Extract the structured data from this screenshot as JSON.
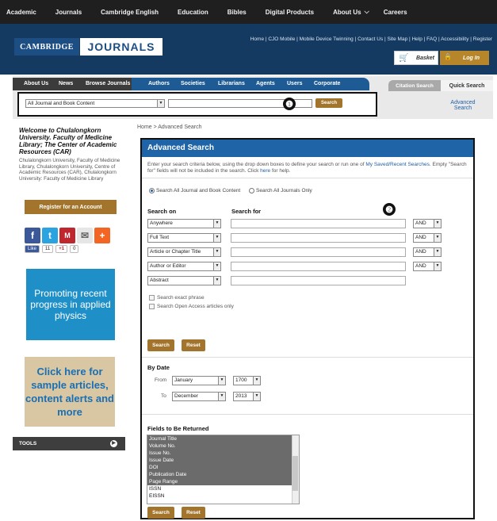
{
  "topnav": [
    "Academic",
    "Journals",
    "Cambridge English",
    "Education",
    "Bibles",
    "Digital Products",
    "About Us",
    "Careers"
  ],
  "logo": {
    "left": "CAMBRIDGE",
    "right": "JOURNALS"
  },
  "toplinks": "Home | CJO Mobile | Mobile Device Twinning | Contact Us | Site Map | Help | FAQ | Accessibility | Register",
  "basket": "Basket",
  "login": "Log In",
  "navtabs": [
    "About Us",
    "News",
    "Browse Journals",
    "Authors",
    "Societies",
    "Librarians",
    "Agents",
    "Users",
    "Corporate"
  ],
  "citation_tab": "Citation Search",
  "quick_tab": "Quick Search",
  "quicksearch": {
    "select": "All Journal and Book Content",
    "button": "Search",
    "advanced": "Advanced Search"
  },
  "markers": [
    "❶",
    "❷"
  ],
  "welcome": "Welcome to Chulalongkorn University. Faculty of Medicine Library; The Center of Academic Resources (CAR)",
  "welcome_sub": "Chulalongkorn University, Faculty of Medicine Library, Chulalongkorn University, Centre of Academic Resources (CAR), Chulalongkorn University: Faculty of Medicine Library",
  "register": "Register for an Account",
  "social_counts": {
    "like": "Like",
    "like_n": "11",
    "gplus": "+1",
    "gplus_n": "0"
  },
  "ad1": "Promoting recent progress in applied physics",
  "ad2": "Click here for sample articles, content alerts and more",
  "tools": "TOOLS",
  "breadcrumb": "Home  >  Advanced Search",
  "adv": {
    "title": "Advanced Search",
    "intro1": "Enter your search criteria below, using the drop down boxes to define your search or run one of",
    "intro_link": "My Saved/Recent Searches",
    "intro2": ". Empty \"Search for\" fields will not be included in the search. Click",
    "intro_here": "here",
    "intro3": "for help.",
    "radio1": "Search All Journal and Book Content",
    "radio2": "Search All Journals Only",
    "search_on": "Search on",
    "search_for": "Search for",
    "rows": [
      {
        "field": "Anywhere",
        "op": "AND"
      },
      {
        "field": "Full Text",
        "op": "AND"
      },
      {
        "field": "Article or Chapter Title",
        "op": "AND"
      },
      {
        "field": "Author or Editor",
        "op": "AND"
      },
      {
        "field": "Abstract",
        "op": ""
      }
    ],
    "exact": "Search exact phrase",
    "openaccess": "Search Open Access articles only",
    "search_btn": "Search",
    "reset_btn": "Reset",
    "bydate": "By Date",
    "from": "From",
    "to": "To",
    "from_month": "January",
    "from_year": "1700",
    "to_month": "December",
    "to_year": "2013",
    "fields_title": "Fields to Be Returned",
    "fields": [
      {
        "name": "Journal Title",
        "selected": true
      },
      {
        "name": "Volume No.",
        "selected": true
      },
      {
        "name": "Issue No.",
        "selected": true
      },
      {
        "name": "Issue Date",
        "selected": true
      },
      {
        "name": "DOI",
        "selected": true
      },
      {
        "name": "Publication Date",
        "selected": true
      },
      {
        "name": "Page Range",
        "selected": true
      },
      {
        "name": "ISSN",
        "selected": false
      },
      {
        "name": "EISSN",
        "selected": false
      }
    ]
  }
}
